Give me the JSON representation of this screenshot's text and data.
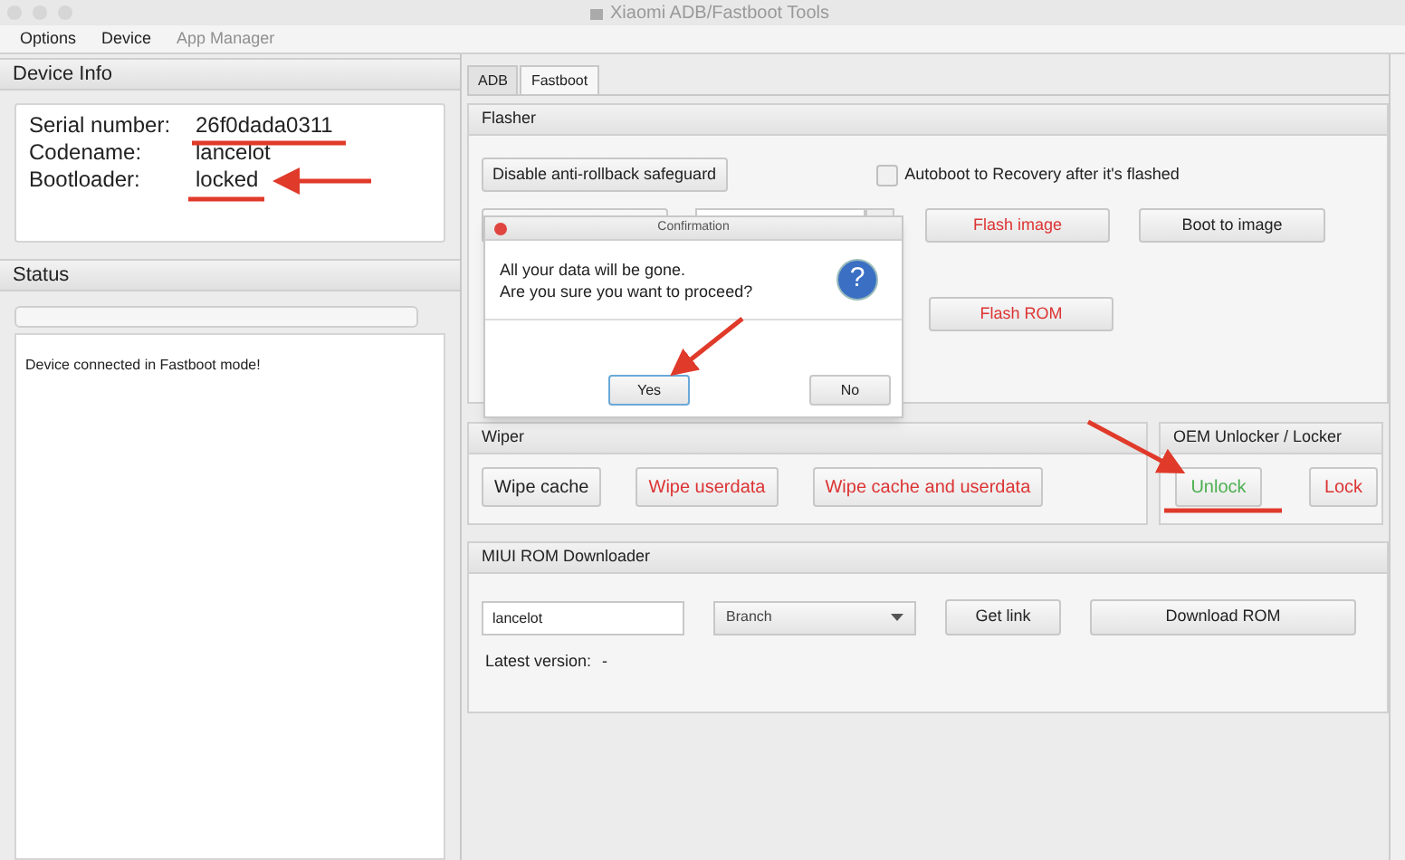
{
  "window": {
    "title": "Xiaomi ADB/Fastboot Tools"
  },
  "menu": [
    {
      "label": "Options",
      "disabled": false
    },
    {
      "label": "Device",
      "disabled": false
    },
    {
      "label": "App Manager",
      "disabled": true
    }
  ],
  "device_info": {
    "title": "Device Info",
    "rows": [
      {
        "label": "Serial number:",
        "value": "26f0dada0311"
      },
      {
        "label": "Codename:",
        "value": "lancelot"
      },
      {
        "label": "Bootloader:",
        "value": "locked"
      }
    ]
  },
  "status": {
    "title": "Status",
    "progress": {
      "level": 0
    },
    "log": "Device connected in Fastboot mode!"
  },
  "tabs": [
    {
      "label": "ADB",
      "selected": false
    },
    {
      "label": "Fastboot",
      "selected": true
    }
  ],
  "flasher": {
    "title": "Flasher",
    "anti_rollback_button": "Disable anti-rollback safeguard",
    "autoboot": {
      "label": "Autoboot to Recovery after it's flashed",
      "checked": false
    },
    "flash_image_button": "Flash image",
    "boot_image_button": "Boot to image",
    "flash_rom_button": "Flash ROM"
  },
  "wiper": {
    "title": "Wiper",
    "buttons": [
      {
        "label": "Wipe cache",
        "danger": false
      },
      {
        "label": "Wipe userdata",
        "danger": true
      },
      {
        "label": "Wipe cache and userdata",
        "danger": true
      }
    ]
  },
  "oem": {
    "title": "OEM Unlocker / Locker",
    "unlock_button": "Unlock",
    "lock_button": "Lock"
  },
  "downloader": {
    "title": "MIUI ROM Downloader",
    "codename_value": "lancelot",
    "branch_placeholder": "Branch",
    "get_link_button": "Get link",
    "download_button": "Download ROM",
    "latest_label": "Latest version:",
    "latest_value": "-"
  },
  "dialog": {
    "title": "Confirmation",
    "message_lines": [
      "All your data will be gone.",
      "Are you sure you want to proceed?"
    ],
    "icon_glyph": "?",
    "yes_button": "Yes",
    "no_button": "No"
  }
}
